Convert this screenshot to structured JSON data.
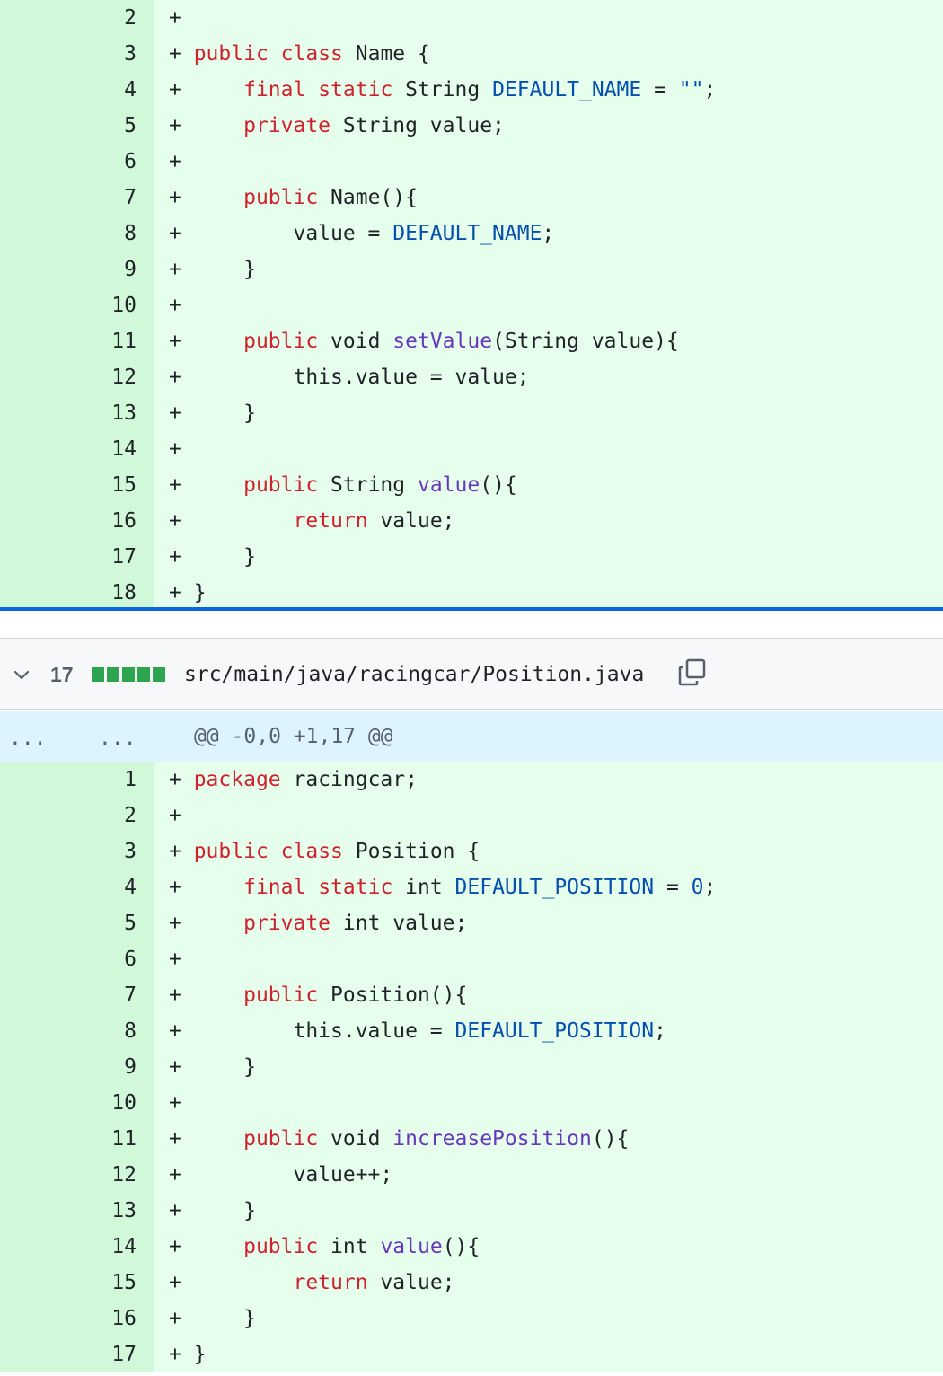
{
  "section1": {
    "lines": [
      {
        "n": "2",
        "html": "+"
      },
      {
        "n": "3",
        "html": "+ <span class=\"kw\">public</span> <span class=\"kw\">class</span> Name {"
      },
      {
        "n": "4",
        "html": "+     <span class=\"kw\">final</span> <span class=\"kw\">static</span> String <span class=\"const\">DEFAULT_NAME</span> = <span class=\"const\">\"\"</span>;"
      },
      {
        "n": "5",
        "html": "+     <span class=\"kw\">private</span> String value;"
      },
      {
        "n": "6",
        "html": "+"
      },
      {
        "n": "7",
        "html": "+     <span class=\"kw\">public</span> Name(){"
      },
      {
        "n": "8",
        "html": "+         value = <span class=\"const\">DEFAULT_NAME</span>;"
      },
      {
        "n": "9",
        "html": "+     }"
      },
      {
        "n": "10",
        "html": "+"
      },
      {
        "n": "11",
        "html": "+     <span class=\"kw\">public</span> void <span class=\"fn\">setValue</span>(String value){"
      },
      {
        "n": "12",
        "html": "+         this.value = value;"
      },
      {
        "n": "13",
        "html": "+     }"
      },
      {
        "n": "14",
        "html": "+"
      },
      {
        "n": "15",
        "html": "+     <span class=\"kw\">public</span> String <span class=\"fn\">value</span>(){"
      },
      {
        "n": "16",
        "html": "+         <span class=\"kw\">return</span> value;"
      },
      {
        "n": "17",
        "html": "+     }"
      },
      {
        "n": "18",
        "html": "+ }"
      }
    ]
  },
  "file_header": {
    "changes_count": "17",
    "diffstat_blocks": 5,
    "path": "src/main/java/racingcar/Position.java",
    "accent_color": "#2da44e"
  },
  "hunk": {
    "left_dots": "...",
    "right_dots": "...",
    "header": "@@ -0,0 +1,17 @@"
  },
  "section2": {
    "lines": [
      {
        "n": "1",
        "html": "+ <span class=\"kw\">package</span> racingcar;"
      },
      {
        "n": "2",
        "html": "+"
      },
      {
        "n": "3",
        "html": "+ <span class=\"kw\">public</span> <span class=\"kw\">class</span> Position {"
      },
      {
        "n": "4",
        "html": "+     <span class=\"kw\">final</span> <span class=\"kw\">static</span> int <span class=\"const\">DEFAULT_POSITION</span> = <span class=\"const\">0</span>;"
      },
      {
        "n": "5",
        "html": "+     <span class=\"kw\">private</span> int value;"
      },
      {
        "n": "6",
        "html": "+"
      },
      {
        "n": "7",
        "html": "+     <span class=\"kw\">public</span> Position(){"
      },
      {
        "n": "8",
        "html": "+         this.value = <span class=\"const\">DEFAULT_POSITION</span>;"
      },
      {
        "n": "9",
        "html": "+     }"
      },
      {
        "n": "10",
        "html": "+"
      },
      {
        "n": "11",
        "html": "+     <span class=\"kw\">public</span> void <span class=\"fn\">increasePosition</span>(){"
      },
      {
        "n": "12",
        "html": "+         value++;"
      },
      {
        "n": "13",
        "html": "+     }"
      },
      {
        "n": "14",
        "html": "+     <span class=\"kw\">public</span> int <span class=\"fn\">value</span>(){"
      },
      {
        "n": "15",
        "html": "+         <span class=\"kw\">return</span> value;"
      },
      {
        "n": "16",
        "html": "+     }"
      },
      {
        "n": "17",
        "html": "+ }"
      }
    ]
  }
}
